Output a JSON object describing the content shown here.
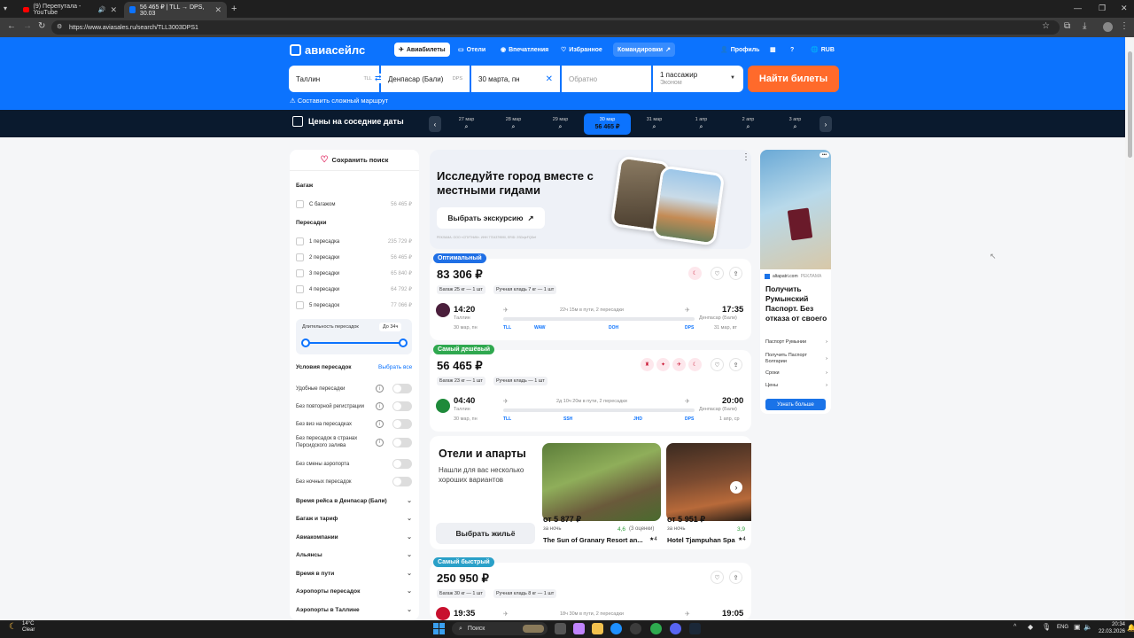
{
  "browser": {
    "tabs": [
      {
        "title": "(9) Перепутала - YouTube"
      },
      {
        "title": "56 465 ₽ | TLL → DPS, 30.03"
      }
    ],
    "url": "https://www.aviasales.ru/search/TLL3003DPS1"
  },
  "header": {
    "logo": "авиасейлс",
    "nav": [
      "Авиабилеты",
      "Отели",
      "Впечатления",
      "Избранное",
      "Командировки"
    ],
    "profile": "Профиль",
    "currency": "RUB"
  },
  "search": {
    "origin": "Таллин",
    "origin_code": "TLL",
    "destination": "Денпасар (Бали)",
    "destination_code": "DPS",
    "depart": "30 марта, пн",
    "return_placeholder": "Обратно",
    "passengers": "1 пассажир",
    "cabin": "Эконом",
    "button": "Найти билеты",
    "complex_route": "Составить сложный маршрут"
  },
  "dates": {
    "label": "Цены на соседние даты",
    "items": [
      "27 мар",
      "28 мар",
      "29 мар",
      "30 мар",
      "31 мар",
      "1 апр",
      "2 апр",
      "3 апр"
    ],
    "active_price": "56 465 ₽"
  },
  "sidebar": {
    "save": "Сохранить поиск",
    "baggage_title": "Багаж",
    "baggage_option": "С багажом",
    "baggage_price": "56 465 ₽",
    "transfers_title": "Пересадки",
    "transfers": [
      {
        "label": "1 пересадка",
        "price": "235 729 ₽"
      },
      {
        "label": "2 пересадки",
        "price": "56 465 ₽"
      },
      {
        "label": "3 пересадки",
        "price": "65 840 ₽"
      },
      {
        "label": "4 пересадки",
        "price": "64 792 ₽"
      },
      {
        "label": "5 пересадок",
        "price": "77 066 ₽"
      }
    ],
    "duration_label": "Длительность пересадок",
    "duration_value": "До 34ч",
    "conditions_title": "Условия пересадок",
    "select_all": "Выбрать все",
    "conditions": [
      "Удобные пересадки",
      "Без повторной регистрации",
      "Без виз на пересадках",
      "Без пересадок в странах Персидского залива",
      "Без смены аэропорта",
      "Без ночных пересадок"
    ],
    "accordions": [
      "Время рейса в Денпасар (Бали)",
      "Багаж и тариф",
      "Авиакомпании",
      "Альянсы",
      "Время в пути",
      "Аэропорты пересадок",
      "Аэропорты в Таллине"
    ]
  },
  "promo": {
    "title": "Исследуйте город вместе с местными гидами",
    "button": "Выбрать экскурсию",
    "footnote": "РЕКЛАМА. ООО «СПУТНИК». ИНН 7704379590, ERID: 2SDnjeFQDef"
  },
  "tickets": [
    {
      "badge": "Оптимальный",
      "price": "83 306 ₽",
      "bag": "Багаж 25 кг — 1 шт",
      "hand": "Ручная кладь 7 кг — 1 шт",
      "dep_time": "14:20",
      "dep_city": "Таллин",
      "dep_date": "30 мар, пн",
      "duration": "22ч 15м в пути, 2 пересадки",
      "arr_time": "17:35",
      "arr_city": "Денпасар (Бали)",
      "arr_date": "31 мар, вт",
      "codes": [
        "TLL",
        "WAW",
        "DOH",
        "DPS"
      ]
    },
    {
      "badge": "Самый дешёвый",
      "price": "56 465 ₽",
      "bag": "Багаж 23 кг — 1 шт",
      "hand": "Ручная кладь — 1 шт",
      "dep_time": "04:40",
      "dep_city": "Таллин",
      "dep_date": "30 мар, пн",
      "duration": "2д 10ч 20м в пути, 2 пересадки",
      "arr_time": "20:00",
      "arr_city": "Денпасар (Бали)",
      "arr_date": "1 апр, ср",
      "codes": [
        "TLL",
        "SSH",
        "JHD",
        "DPS"
      ]
    },
    {
      "badge": "Самый быстрый",
      "price": "250 950 ₽",
      "bag": "Багаж 30 кг — 1 шт",
      "hand": "Ручная кладь 8 кг — 1 шт",
      "dep_time": "19:35",
      "duration": "18ч 30м в пути, 2 пересадки",
      "arr_time": "19:05"
    }
  ],
  "hotels": {
    "title": "Отели и апарты",
    "subtitle": "Нашли для вас несколько хороших вариантов",
    "button": "Выбрать жильё",
    "items": [
      {
        "price": "от 5 877 ₽",
        "per": "за ночь",
        "rating": "4,6",
        "reviews": "(3 оценки)",
        "name": "The Sun of Granary Resort an...",
        "stars": "★4"
      },
      {
        "price": "от 5 951 ₽",
        "per": "за ночь",
        "rating": "3,9",
        "name": "Hotel Tjampuhan Spa",
        "stars": "★4"
      }
    ]
  },
  "ad": {
    "source": "altapatri.com",
    "label": "РЕКЛАМА",
    "title": "Получить Румынский Паспорт. Без отказа от своего",
    "links": [
      "Паспорт Румынии",
      "Получить Паспорт Болгарии",
      "Сроки",
      "Цены"
    ],
    "button": "Узнать больше"
  },
  "taskbar": {
    "weather_temp": "14°C",
    "weather_desc": "Clear",
    "search": "Поиск",
    "lang": "ENG",
    "time": "20:34",
    "date": "22.03.2026"
  }
}
